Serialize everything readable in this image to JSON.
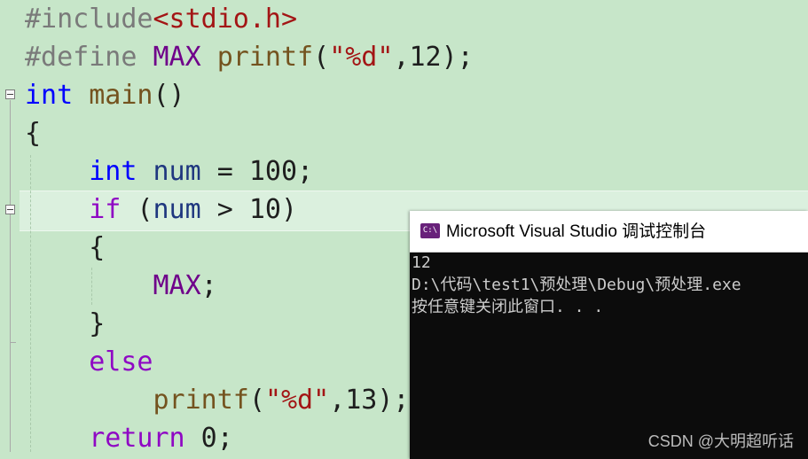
{
  "editor": {
    "line1": {
      "directive": "#include",
      "header": "<stdio.h>"
    },
    "line2": {
      "directive": "#define ",
      "macro": "MAX",
      "sp": " ",
      "fn": "printf",
      "open": "(",
      "str": "\"%d\"",
      "rest": ",12);"
    },
    "line3": {
      "type": "int",
      "sp": " ",
      "name": "main",
      "parens": "()"
    },
    "line4": {
      "text": "{"
    },
    "line5": {
      "indent": "    ",
      "type": "int",
      "sp": " ",
      "var": "num",
      "rest": " = 100;"
    },
    "line6": {
      "indent": "    ",
      "kw": "if",
      "rest1": " (",
      "var": "num",
      "rest2": " > 10)"
    },
    "line7": {
      "indent": "    ",
      "text": "{"
    },
    "line8": {
      "indent": "        ",
      "macro": "MAX",
      "rest": ";"
    },
    "line9": {
      "indent": "    ",
      "text": "}"
    },
    "line10": {
      "indent": "    ",
      "kw": "else"
    },
    "line11": {
      "indent": "        ",
      "fn": "printf",
      "open": "(",
      "str": "\"%d\"",
      "rest": ",13);"
    },
    "line12": {
      "indent": "    ",
      "kw": "return",
      "rest": " 0;"
    }
  },
  "console": {
    "title": "Microsoft Visual Studio 调试控制台",
    "icon_name": "visual-studio-console-icon",
    "icon_text": "C:\\",
    "lines": [
      "12",
      "D:\\代码\\test1\\预处理\\Debug\\预处理.exe",
      "按任意键关闭此窗口. . ."
    ]
  },
  "watermark": "CSDN @大明超听话"
}
